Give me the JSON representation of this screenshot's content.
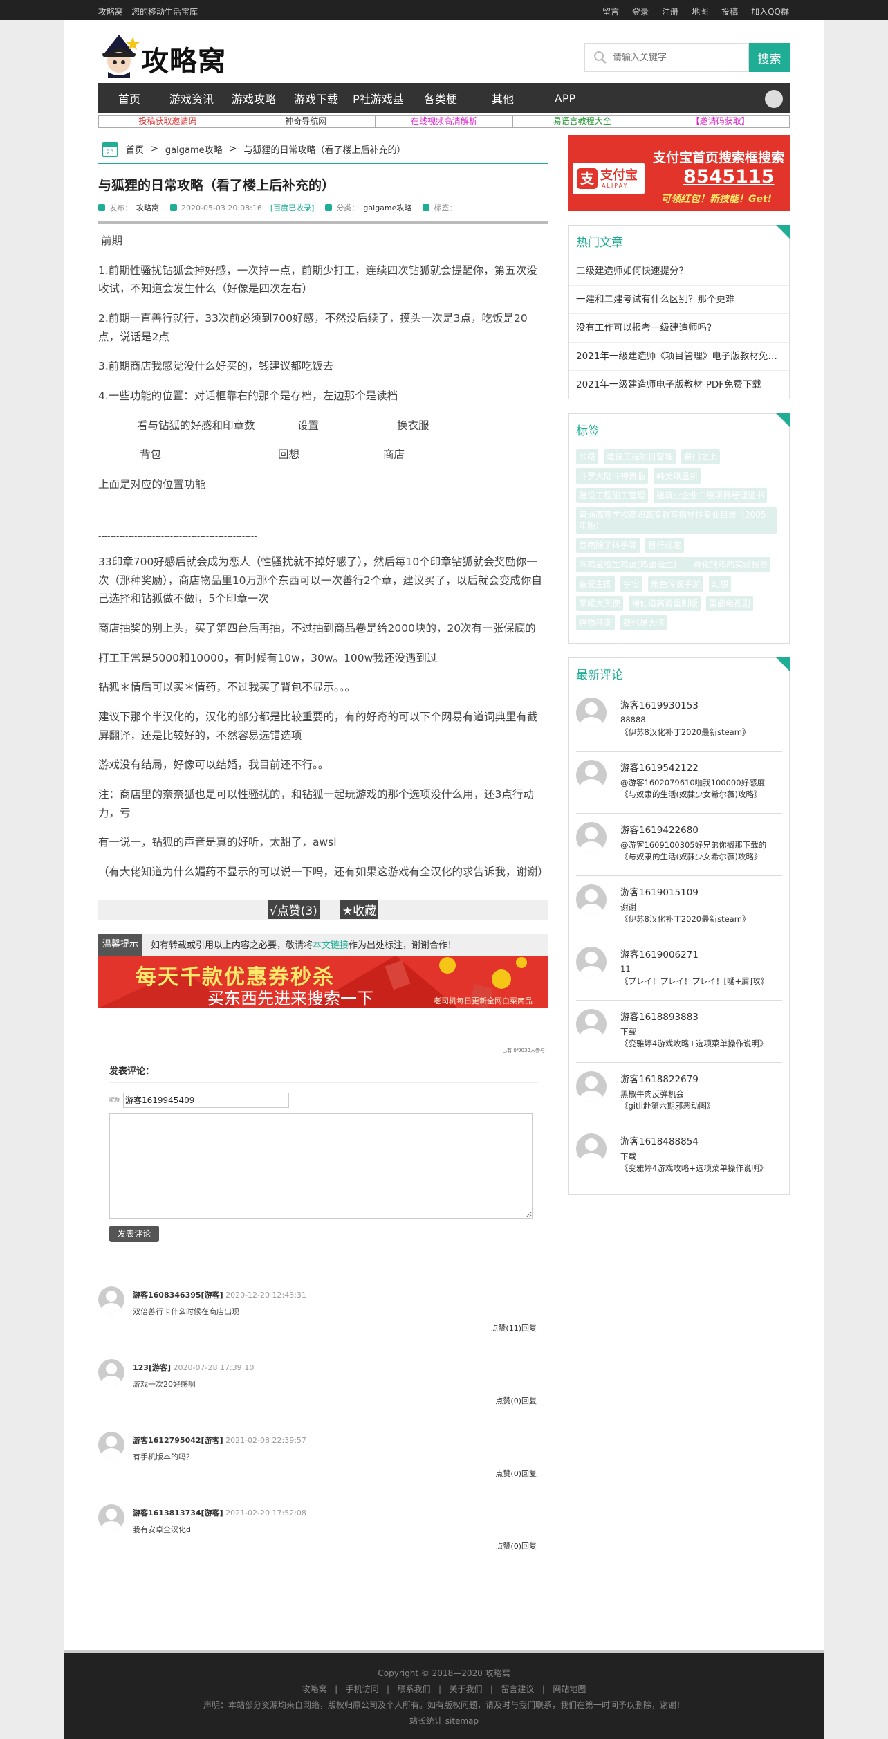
{
  "topbar": {
    "slogan": "攻略窝 - 您的移动生活宝库",
    "links": [
      "留言",
      "登录",
      "注册",
      "地图",
      "投稿",
      "加入QQ群"
    ]
  },
  "header": {
    "logo_text": "攻略窝",
    "search_placeholder": "请输入关键字",
    "search_button": "搜索"
  },
  "nav": [
    "首页",
    "游戏资讯",
    "游戏攻略",
    "游戏下载",
    "P社游戏基",
    "各类梗",
    "其他",
    "APP"
  ],
  "sublinks": [
    {
      "label": "投稿获取邀请码",
      "color": "#e53333"
    },
    {
      "label": "神奇导航网",
      "color": "#333333"
    },
    {
      "label": "在线视频高清解析",
      "color": "#e020d0"
    },
    {
      "label": "易语言教程大全",
      "color": "#1f9a2e"
    },
    {
      "label": "【邀请码获取】",
      "color": "#e020d0"
    }
  ],
  "breadcrumb": {
    "home": "首页",
    "sep": ">",
    "category": "galgame攻略",
    "current": "与狐狸的日常攻略（看了楼上后补充的）"
  },
  "article": {
    "title": "与狐狸的日常攻略（看了楼上后补充的）",
    "meta": {
      "author_label": "发布：",
      "author": "攻略窝",
      "date": "2020-05-03 20:08:16",
      "indexed": "[百度已收录]",
      "category_label": "分类：",
      "category": "galgame攻略",
      "tags_label": "标签："
    },
    "p0": "前期",
    "p1": "1.前期性骚扰钻狐会掉好感，一次掉一点，前期少打工，连续四次钻狐就会提醒你，第五次没收试，不知道会发生什么（好像是四次左右）",
    "p2": "2.前期一直善行就行，33次前必须到700好感，不然没后续了，摸头一次是3点，吃饭是20点，说话是2点",
    "p3": "3.前期商店我感觉没什么好买的，钱建议都吃饭去",
    "p4": "4.一些功能的位置：对话框靠右的那个是存档，左边那个是读档",
    "grid_row1": [
      "看与钻狐的好感和印章数",
      "设置",
      "换衣服"
    ],
    "grid_row2": [
      "背包",
      "回想",
      "商店"
    ],
    "p5": "上面是对应的位置功能",
    "divider": "-----------------------------------------------------------------------------------------------------------------------------------------------------------------------------------------------------------",
    "p6": "33印章700好感后就会成为恋人（性骚扰就不掉好感了），然后每10个印章钻狐就会奖励你一次（那种奖励），商店物品里10万那个东西可以一次善行2个章，建议买了，以后就会变成你自己选择和钻狐做不做i，5个印章一次",
    "p7": "商店抽奖的别上头，买了第四台后再抽，不过抽到商品卷是给2000块的，20次有一张保底的",
    "p8": "打工正常是5000和10000，有时候有10w，30w。100w我还没遇到过",
    "p9": "钻狐＊情后可以买＊情药，不过我买了背包不显示。。。",
    "p10": "建议下那个半汉化的，汉化的部分都是比较重要的，有的好奇的可以下个网易有道词典里有截屏翻译，还是比较好的，不然容易选错选项",
    "p11": "游戏没有结局，好像可以结婚，我目前还不行。。",
    "p12": "注：商店里的奈奈狐也是可以性骚扰的，和钻狐一起玩游戏的那个选项没什么用，还3点行动力，亏",
    "p13": "有一说一，钻狐的声音是真的好听，太甜了，awsl",
    "p14": "（有大佬知道为什么媚药不显示的可以说一下吗，还有如果这游戏有全汉化的求告诉我，谢谢）"
  },
  "likebar": {
    "like": "√点赞(3)",
    "fav": "★收藏"
  },
  "tips": {
    "label": "温馨提示",
    "pre": "如有转载或引用以上内容之必要，敬请将",
    "link": "本文链接",
    "post": "作为出处标注，谢谢合作！"
  },
  "banner": {
    "t1": "每天千款优惠券秒杀",
    "t2": "买东西先进来搜索一下",
    "t3": "老司机每日更新全网白菜商品"
  },
  "comment_form": {
    "joined": "已有 0/9033人参与",
    "title": "发表评论：",
    "name_label": "昵称",
    "name_value": "游客1619945409",
    "submit": "发表评论"
  },
  "comments": [
    {
      "user": "游客1608346395[游客]",
      "time": "2020-12-20 12:43:31",
      "text": "双倍善行卡什么时候在商店出现",
      "action": "点赞(11)回复"
    },
    {
      "user": "123[游客]",
      "time": "2020-07-28 17:39:10",
      "text": "游戏一次20好感啊",
      "action": "点赞(0)回复"
    },
    {
      "user": "游客1612795042[游客]",
      "time": "2021-02-08 22:39:57",
      "text": "有手机版本的吗？",
      "action": "点赞(0)回复"
    },
    {
      "user": "游客1613813734[游客]",
      "time": "2021-02-20 17:52:08",
      "text": "我有安卓全汉化d",
      "action": "点赞(0)回复"
    }
  ],
  "side_ad": {
    "logo_icon": "支",
    "logo_name": "支付宝",
    "logo_en": "ALIPAY",
    "a1": "支付宝首页搜索框搜索",
    "a2": "8545115",
    "a3": "可领红包！新技能！Get!"
  },
  "hot": {
    "title": "热门文章",
    "items": [
      "二级建造师如何快速提分？",
      "一建和二建考试有什么区别？那个更难",
      "没有工作可以报考一级建造师吗？",
      "2021年一级建造师《项目管理》电子版教材免费下载",
      "2021年一级建造师电子版教材-PDF免费下载"
    ]
  },
  "tags": {
    "title": "标签",
    "items": [
      "公路",
      "建设工程项目管理",
      "奋门之上",
      "斗罗大陆斗神再临",
      "韩美琪量新",
      "建设工程施工管理",
      "建筑业企业二级项目经理证书",
      "普通高等学校高职高专教育指导性专业目录（2005年版）",
      "西南除了体手等",
      "暂行规定",
      "熊鸡萤或生鸡蛋(鸡蛋诞生)——孵化钱鸡的实验报告",
      "备受主国",
      "宇宙",
      "角色传说手游",
      "幻想",
      "荣耀大天使",
      "神仙道高清重制版",
      "萤能电视剧",
      "怪物狂潮",
      "我也是大侠"
    ]
  },
  "recent": {
    "title": "最新评论",
    "items": [
      {
        "name": "游客1619930153",
        "content": "88888",
        "post": "《伊苏8汉化补丁2020最新steam》"
      },
      {
        "name": "游客1619542122",
        "content": "@游客1602079610啪我100000好感度",
        "post": "《与奴隶的生活(奴隷少女希尔薇)攻略》"
      },
      {
        "name": "游客1619422680",
        "content": "@游客1609100305好兄弟你搁那下载的",
        "post": "《与奴隶的生活(奴隷少女希尔薇)攻略》"
      },
      {
        "name": "游客1619015109",
        "content": "谢谢",
        "post": "《伊苏8汉化补丁2020最新steam》"
      },
      {
        "name": "游客1619006271",
        "content": "11",
        "post": "《プレイ！プレイ！プレイ！[嗵+屑]攻》"
      },
      {
        "name": "游客1618893883",
        "content": "下载",
        "post": "《变雅婷4游戏攻略+选项菜单操作说明》"
      },
      {
        "name": "游客1618822679",
        "content": "黑椒牛肉反弹机会",
        "post": "《gitli赴第六期邪恶动图》"
      },
      {
        "name": "游客1618488854",
        "content": "下载",
        "post": "《变雅婷4游戏攻略+选项菜单操作说明》"
      }
    ]
  },
  "footer": {
    "copyright": "Copyright © 2018—2020 攻略窝",
    "links": "攻略窝   |   手机访问   |   联系我们   |   关于我们   |   留言建议   |   网站地图",
    "notice": "声明：本站部分资源均来自网络，版权归原公司及个人所有。如有版权问题，请及时与我们联系，我们在第一时间予以删除，谢谢！",
    "stats": "站长统计 sitemap"
  },
  "colors": {
    "accent": "#1fae95",
    "dark": "#333333",
    "alipay": "#e2342a"
  }
}
